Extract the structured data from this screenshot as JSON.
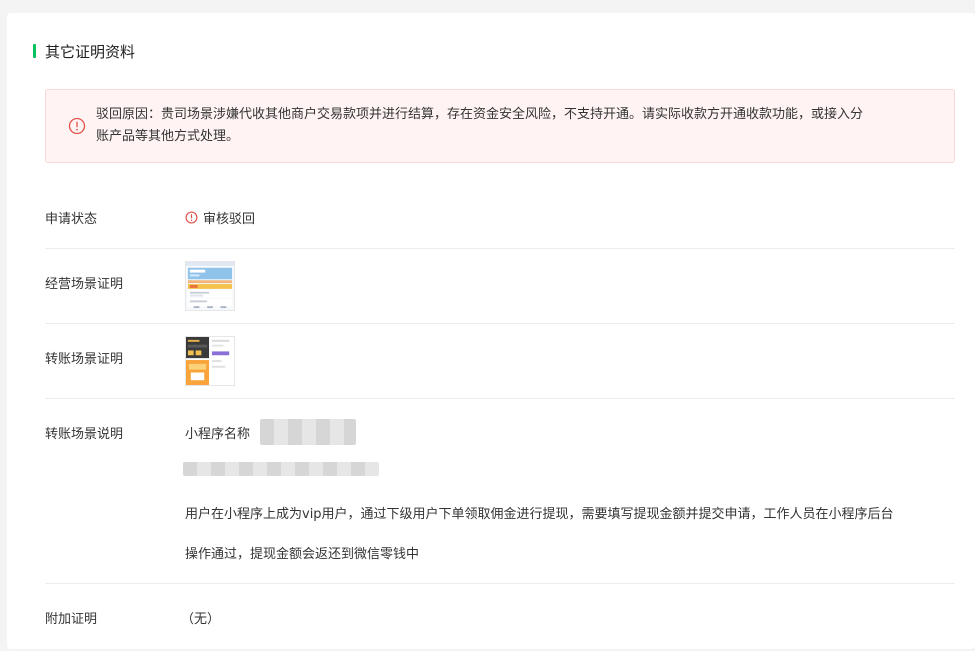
{
  "section": {
    "title": "其它证明资料"
  },
  "alert": {
    "line1": "驳回原因：贵司场景涉嫌代收其他商户交易款项并进行结算，存在资金安全风险，不支持开通。请实际收款方开通收款功能，或接入分",
    "line2": "账产品等其他方式处理。",
    "color": "#e0534a"
  },
  "rows": {
    "status": {
      "label": "申请状态",
      "value": "审核驳回"
    },
    "business_proof": {
      "label": "经营场景证明"
    },
    "transfer_proof": {
      "label": "转账场景证明"
    },
    "transfer_desc": {
      "label": "转账场景说明",
      "mini_program_label": "小程序名称",
      "desc_line1": "用户在小程序上成为vip用户，通过下级用户下单领取佣金进行提现，需要填写提现金额并提交申请，工作人员在小程序后台",
      "desc_line2": "操作通过，提现金额会返还到微信零钱中"
    },
    "extra_proof": {
      "label": "附加证明",
      "value": "（无）"
    }
  },
  "colors": {
    "accent": "#07c160",
    "error": "#e0534a"
  }
}
